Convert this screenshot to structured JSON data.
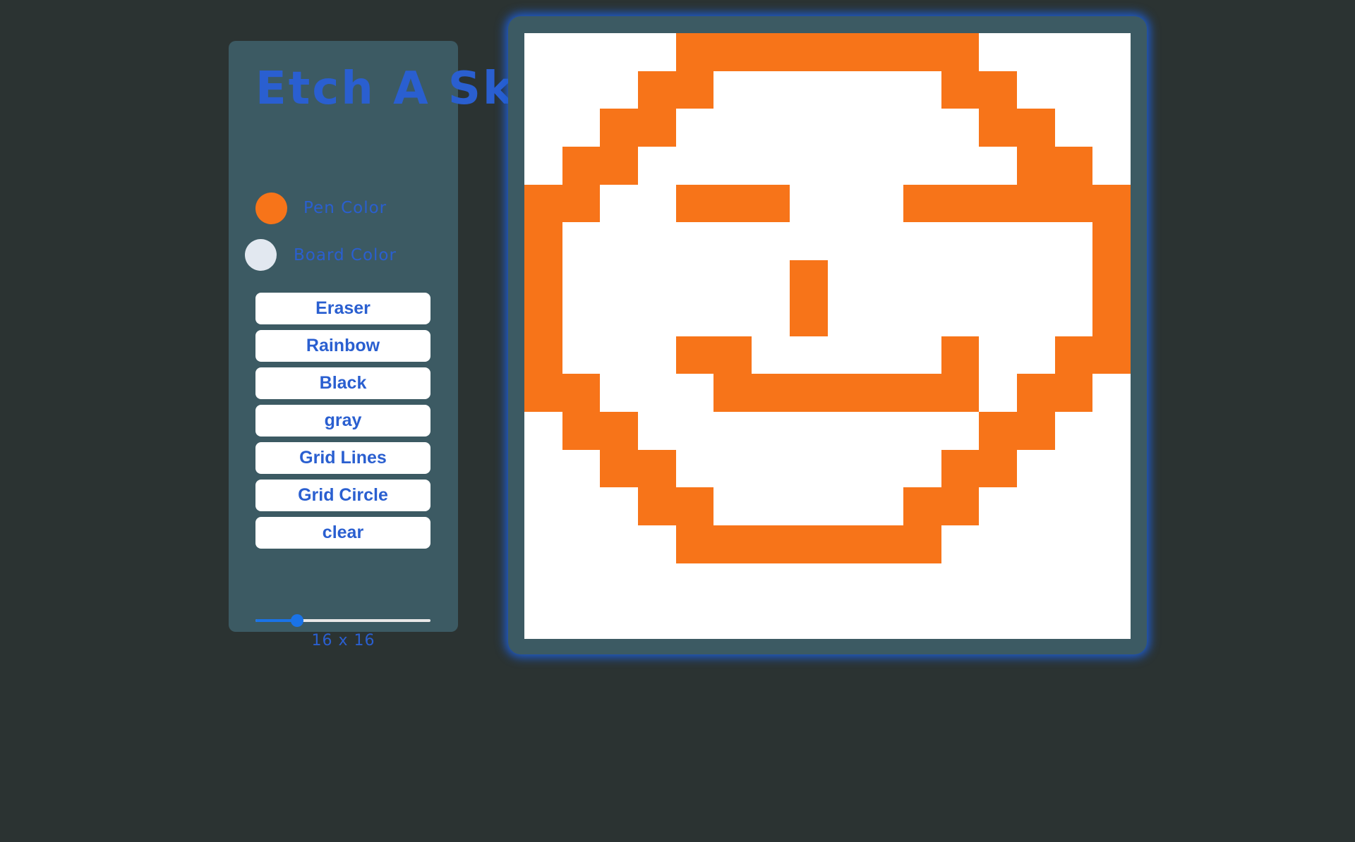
{
  "app": {
    "title": "Etch A Sketch"
  },
  "colors": {
    "pen": "#f77419",
    "board": "#e2e8f0",
    "cell_empty": "#ffffff",
    "accent": "#2a5fd0"
  },
  "controls": {
    "pen_label": "Pen Color",
    "board_label": "Board Color",
    "buttons": [
      {
        "label": "Eraser"
      },
      {
        "label": "Rainbow"
      },
      {
        "label": "Black"
      },
      {
        "label": "gray"
      },
      {
        "label": "Grid Lines"
      },
      {
        "label": "Grid Circle"
      },
      {
        "label": "clear"
      }
    ],
    "grid_size": 16,
    "size_label": "16 x 16",
    "slider": {
      "min": 1,
      "max": 64,
      "value": 16
    }
  },
  "board": {
    "rows": [
      "0000111111110000",
      "0001100000011000",
      "0011000000001100",
      "0110000000000110",
      "1100111000111111",
      "1000000000000001",
      "1000000100000001",
      "1000000100000001",
      "1000110000010011",
      "1100011111110110",
      "0110000000001100",
      "0011000000011000",
      "0001100000110000",
      "0000111111100000",
      "0000000000000000",
      "0000000000000000"
    ]
  }
}
